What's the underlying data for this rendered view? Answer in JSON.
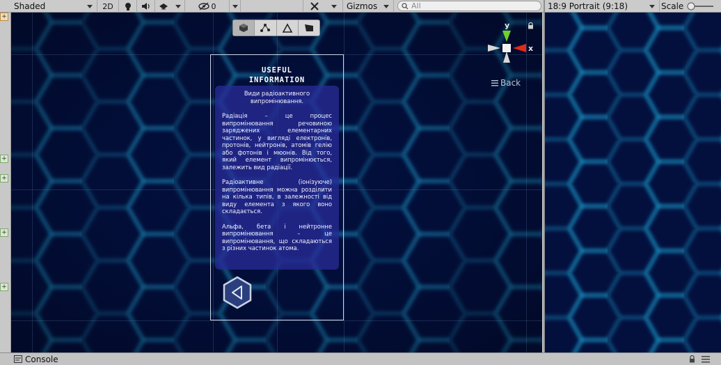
{
  "toolbar": {
    "shading_mode": "Shaded",
    "mode_2d": "2D",
    "gizmos_label": "Gizmos",
    "search_placeholder": "All",
    "hidden_count": "0"
  },
  "game_view": {
    "aspect_label": "18:9 Portrait (9:18)",
    "scale_label": "Scale"
  },
  "scene": {
    "gizmo_axis_y": "y",
    "gizmo_axis_x": "x",
    "back_label": "Back",
    "panel": {
      "title_line1": "USEFUL",
      "title_line2": "INFORMATION",
      "subtitle": "Види радіоактивного випромінювання.",
      "paragraphs": [
        "Радіація – це процес випромінювання речовиною заряджених елементарних частинок, у вигляді електронів, протонів, нейтронів, атомів гелію або фотонів і мюонів. Від того, який елемент випромінюється, залежить вид радіації.",
        "Радіоактивне (іонізуюче) випромінювання можна розділити на кілька типів, в залежності від виду елемента з якого воно складається.",
        "Альфа, бета і нейтронне випромінювання – це випромінювання, що складаються з різних частинок атома."
      ]
    }
  },
  "console": {
    "label": "Console"
  },
  "colors": {
    "scene_bg": "#020b34",
    "hex_glow": "#1fa6d8",
    "panel_bg": "#2a2c96",
    "gizmo_y": "#6fd12a",
    "gizmo_x": "#e02a1a"
  }
}
